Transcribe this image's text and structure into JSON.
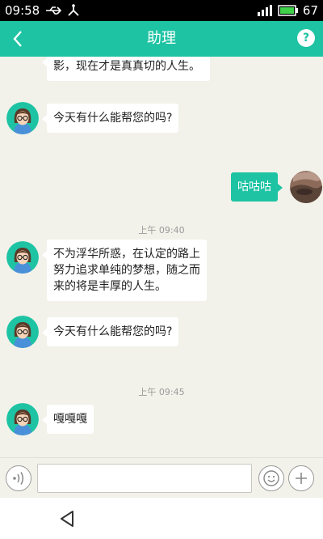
{
  "status_bar": {
    "time": "09:58",
    "battery": "67"
  },
  "header": {
    "title": "助理",
    "help_label": "?"
  },
  "messages": [
    {
      "type": "bot",
      "text": "影，现在才是真真切的人生。"
    },
    {
      "type": "bot",
      "text": "今天有什么能帮您的吗?"
    },
    {
      "type": "user",
      "text": "咕咕咕"
    },
    {
      "type": "time",
      "text": "上午 09:40"
    },
    {
      "type": "bot",
      "lines": [
        "不为浮华所惑，在认定的路上",
        "努力追求单纯的梦想，随之而",
        "来的将是丰厚的人生。"
      ]
    },
    {
      "type": "bot",
      "text": "今天有什么能帮您的吗?"
    },
    {
      "type": "time",
      "text": "上午 09:45"
    },
    {
      "type": "bot",
      "text": "嘎嘎嘎"
    }
  ],
  "input": {
    "value": "",
    "placeholder": ""
  },
  "colors": {
    "accent": "#1ec3a3",
    "background": "#f2f2ea",
    "status_bar": "#000000"
  }
}
